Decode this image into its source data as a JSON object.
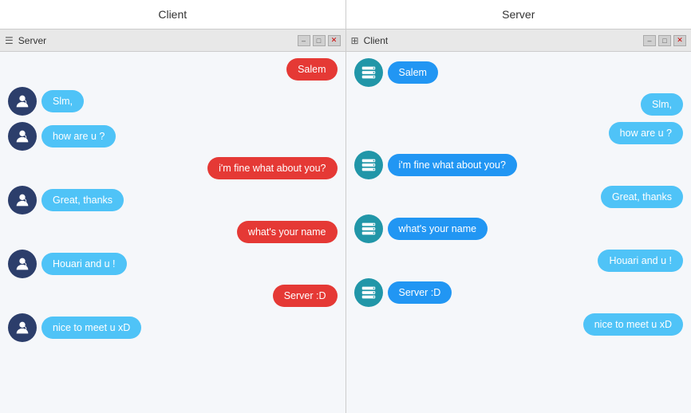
{
  "headers": {
    "client_label": "Client",
    "server_label": "Server"
  },
  "client_window": {
    "titlebar_text": "Server",
    "messages": [
      {
        "side": "right",
        "type": "red",
        "text": "Salem",
        "avatar": false
      },
      {
        "side": "left",
        "type": "light-blue",
        "text": "Slm,",
        "avatar": "person"
      },
      {
        "side": "left",
        "type": "light-blue",
        "text": "how are u ?",
        "avatar": "person"
      },
      {
        "side": "right",
        "type": "red",
        "text": "i'm fine what about you?",
        "avatar": false
      },
      {
        "side": "left",
        "type": "light-blue",
        "text": "Great, thanks",
        "avatar": "person"
      },
      {
        "side": "right",
        "type": "red",
        "text": "what's your name",
        "avatar": false
      },
      {
        "side": "left",
        "type": "light-blue",
        "text": "Houari and u !",
        "avatar": "person"
      },
      {
        "side": "right",
        "type": "red",
        "text": "Server :D",
        "avatar": false
      },
      {
        "side": "left",
        "type": "light-blue",
        "text": "nice to meet u xD",
        "avatar": "person"
      }
    ]
  },
  "server_window": {
    "titlebar_text": "Client",
    "messages": [
      {
        "side": "left",
        "type": "blue",
        "text": "Salem",
        "avatar": "server"
      },
      {
        "side": "right",
        "type": "light-blue",
        "text": "Slm,",
        "avatar": false
      },
      {
        "side": "right",
        "type": "light-blue",
        "text": "how are u ?",
        "avatar": false
      },
      {
        "side": "left",
        "type": "blue",
        "text": "i'm fine what about you?",
        "avatar": "server"
      },
      {
        "side": "right",
        "type": "light-blue",
        "text": "Great, thanks",
        "avatar": false
      },
      {
        "side": "left",
        "type": "blue",
        "text": "what's your name",
        "avatar": "server"
      },
      {
        "side": "right",
        "type": "light-blue",
        "text": "Houari and u !",
        "avatar": false
      },
      {
        "side": "left",
        "type": "blue",
        "text": "Server :D",
        "avatar": "server"
      },
      {
        "side": "right",
        "type": "light-blue",
        "text": "nice to meet u xD",
        "avatar": false
      }
    ]
  }
}
